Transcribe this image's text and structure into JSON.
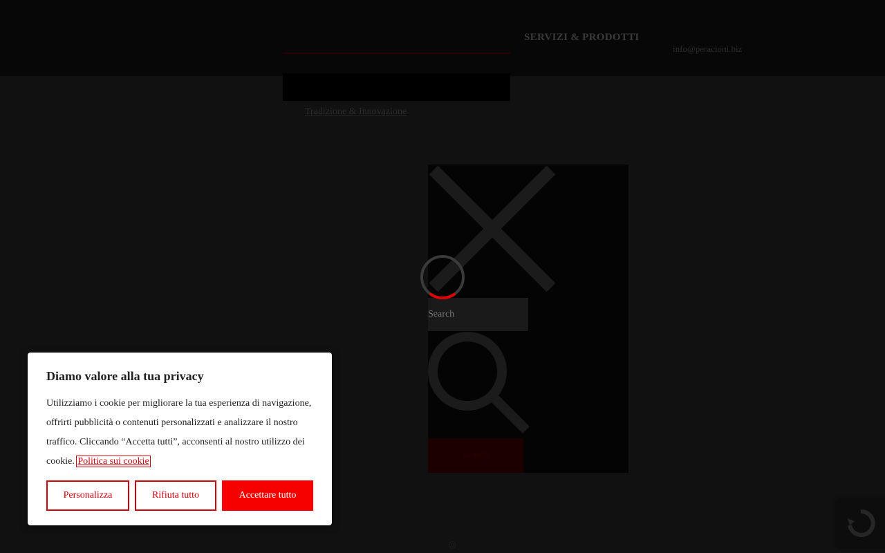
{
  "header": {
    "nav_red_label": "",
    "services_label": "SERVIZI & PRODOTTI",
    "email": "info@peracioni.biz",
    "dropdown_item": "",
    "subnav_link": "Tradizione & Innovazione"
  },
  "search": {
    "placeholder": "Search",
    "submit_label": "Search"
  },
  "cookie_banner": {
    "title": "Diamo valore alla tua privacy",
    "text": "Utilizziamo i cookie per migliorare la tua esperienza di navigazione, offrirti pubblicità o contenuti personalizzati e analizzare il nostro traffico. Cliccando “Accetta tutti”, acconsenti al nostro utilizzo dei cookie.",
    "policy_link": "Politica sui cookie",
    "customize_label": "Personalizza",
    "reject_label": "Rifiuta tutto",
    "accept_label": "Accettare tutto"
  },
  "colors": {
    "accent": "#f70000",
    "accent_border": "#d2000d",
    "backdrop": "#111111"
  },
  "icons": [
    "close-icon",
    "search-icon",
    "loading-spinner",
    "recaptcha-icon"
  ]
}
